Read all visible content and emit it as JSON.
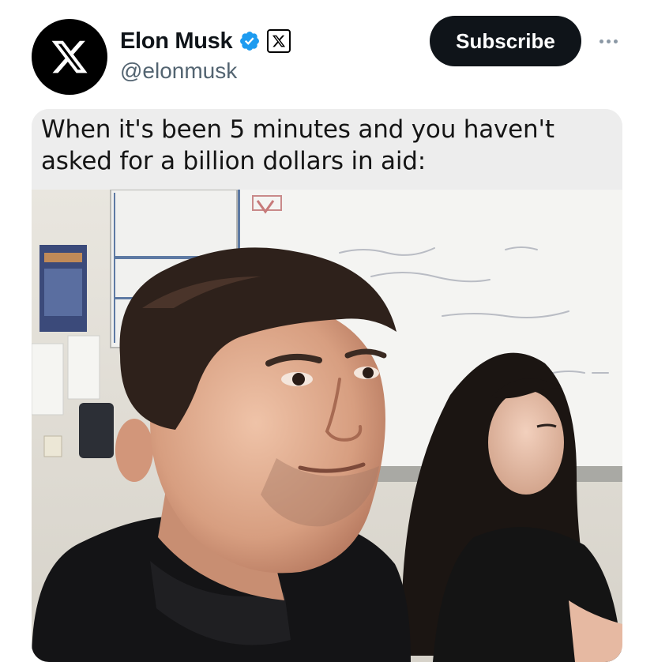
{
  "author": {
    "display_name": "Elon Musk",
    "handle": "@elonmusk",
    "avatar_icon": "x-logo-icon",
    "verified_icon": "verified-badge-icon",
    "affiliate_icon": "x-affiliate-badge-icon"
  },
  "actions": {
    "subscribe_label": "Subscribe",
    "more_icon": "more-horizontal-icon"
  },
  "post": {
    "meme_caption": "When it's been 5 minutes and you haven't asked for a billion dollars in aid:"
  },
  "colors": {
    "verified_blue": "#1d9bf0",
    "subscribe_bg": "#0f1419",
    "handle_gray": "#536471"
  }
}
